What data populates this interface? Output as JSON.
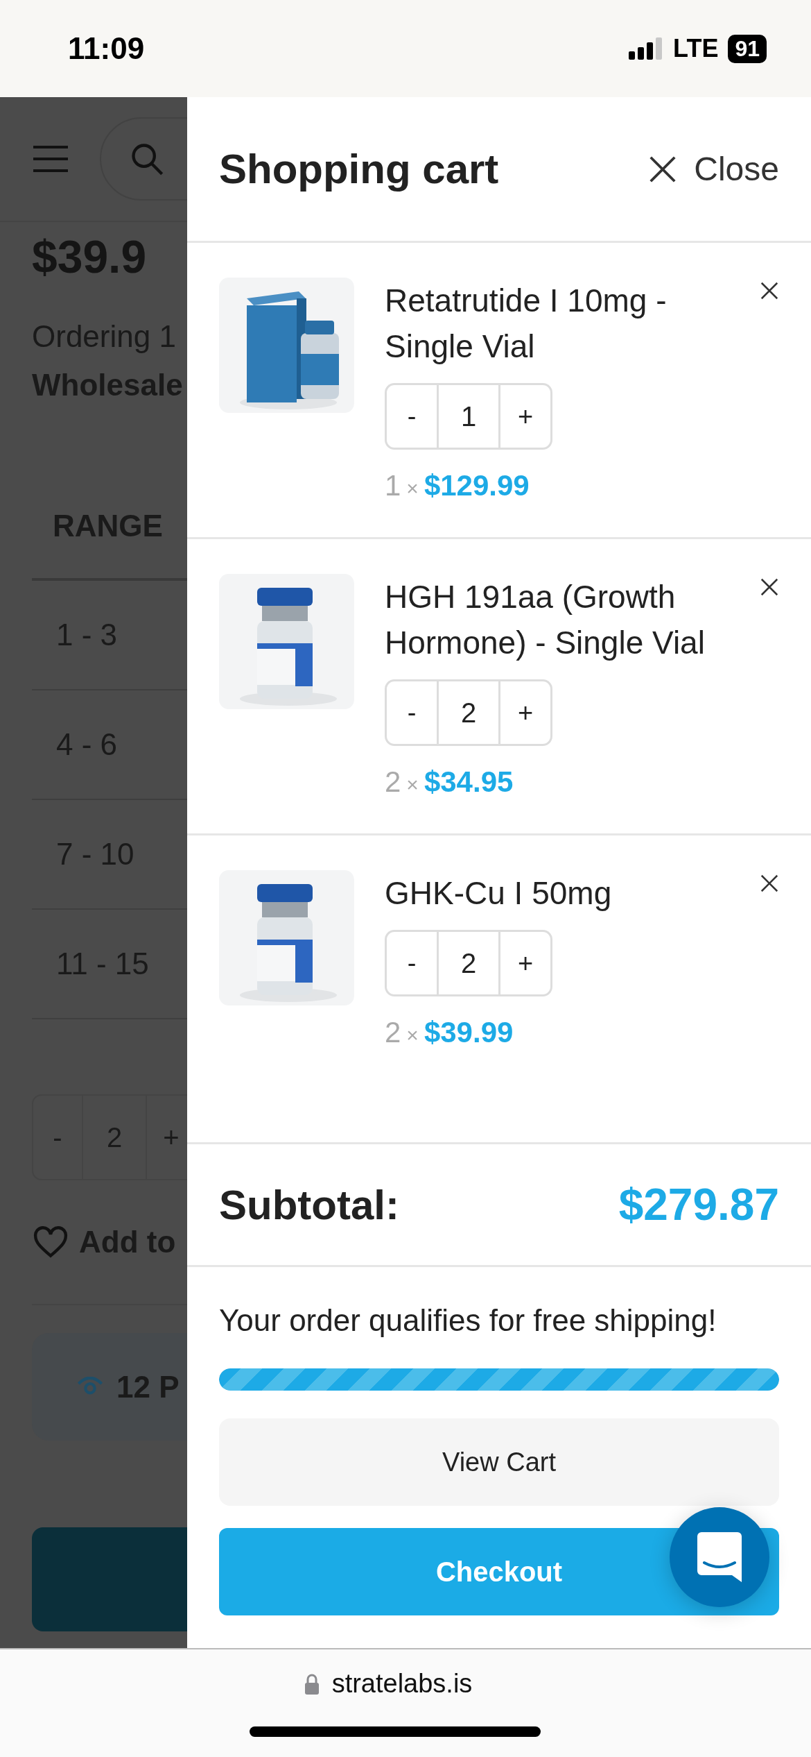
{
  "status_bar": {
    "time": "11:09",
    "network": "LTE",
    "battery": "91"
  },
  "background_page": {
    "price": "$39.9",
    "ordering_text": "Ordering 1",
    "wholesale_text": "Wholesale",
    "table_header": "RANGE",
    "ranges": [
      "1 - 3",
      "4 - 6",
      "7 - 10",
      "11 - 15"
    ],
    "quantity": {
      "minus": "-",
      "value": "2",
      "plus": "+"
    },
    "wishlist": "Add to",
    "viewers": "12 P"
  },
  "cart": {
    "title": "Shopping cart",
    "close": "Close",
    "items": [
      {
        "name": "Retatrutide I 10mg - Single Vial",
        "minus": "-",
        "quantity": "1",
        "plus": "+",
        "count": "1",
        "times": "×",
        "price": "$129.99"
      },
      {
        "name": "HGH 191aa (Growth Hormone) - Single Vial",
        "minus": "-",
        "quantity": "2",
        "plus": "+",
        "count": "2",
        "times": "×",
        "price": "$34.95"
      },
      {
        "name": "GHK-Cu I 50mg",
        "minus": "-",
        "quantity": "2",
        "plus": "+",
        "count": "2",
        "times": "×",
        "price": "$39.99"
      }
    ],
    "subtotal_label": "Subtotal:",
    "subtotal": "$279.87",
    "shipping_message": "Your order qualifies for free shipping!",
    "shipping_progress": {
      "level": 1
    },
    "view_cart": "View Cart",
    "checkout": "Checkout"
  },
  "browser": {
    "url": "stratelabs.is"
  }
}
